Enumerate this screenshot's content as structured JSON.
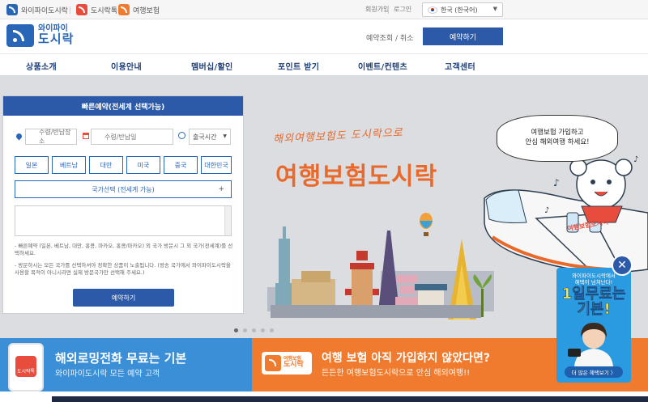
{
  "topbar": {
    "sites": [
      {
        "label": "와이파이도시락",
        "icon": "wifi-dosirak-icon"
      },
      {
        "label": "도시락톡",
        "icon": "dosirak-talk-icon"
      },
      {
        "label": "여행보험",
        "icon": "travel-insurance-icon"
      }
    ],
    "signup": "회원가입",
    "login": "로그인",
    "language": "한국 (한국어)"
  },
  "header": {
    "logo_small": "와이파이",
    "logo_big": "도시락",
    "reservation_lookup": "예약조회 / 취소",
    "reserve_button": "예약하기"
  },
  "nav": [
    "상품소개",
    "이용안내",
    "멤버십/할인",
    "포인트 받기",
    "이벤트/컨텐츠",
    "고객센터"
  ],
  "quick_booking": {
    "title": "빠른예약(전세계 선택가능)",
    "pickup_placeholder": "수령/반납장소",
    "date_placeholder": "수령/반납일",
    "departure_time": "출국시간",
    "countries": [
      "일본",
      "베트남",
      "대만",
      "미국",
      "중국",
      "대한민국"
    ],
    "country_select": "국가선택 (전세계 가능)",
    "note1": "- 빠른예약 (일본, 베트남, 대만, 홍콩, 마카오, 홍콩/마카오) 외 국가 방문시 그 외 국가(전세계)를 선택하세요.",
    "note2": "- 방문하시는 모든 국가를 선택하셔야 정확한 상품이 노출됩니다. (왕송 국가에서 와이파이도시락을 사용할 목적이 아니시라면 실제 방문국가만 선택해 주세요.)",
    "submit": "예약하기"
  },
  "hero": {
    "handwriting": "해외여행보험도 도시락으로",
    "title": "여행보험도시락",
    "bubble_line1": "여행보험 가입하고",
    "bubble_line2": "안심 해외여행 하세요!",
    "plane_label": "여행보험도시락",
    "slide_count": 5,
    "active_slide": 0
  },
  "side_promo": {
    "line1": "와이파이도시락에서",
    "line2": "혜택이 넘쳐난다!",
    "big1": "1일무료는",
    "big2": "기본!",
    "button": "더 많은 혜택보기 〉",
    "close": "✕"
  },
  "banners": {
    "left_title": "해외로밍전화 무료는 기본",
    "left_sub": "와이파이도시락 모든 예약 고객",
    "left_app": "도시락톡",
    "right_logo_small": "여행보험",
    "right_logo_big": "도시락",
    "right_title": "여행 보험 아직 가입하지 않았다면?",
    "right_sub": "든든한 여행보험도시락으로 안심 해외여행!!"
  },
  "colors": {
    "primary_blue": "#2d5aa8",
    "brand_orange": "#e9692a",
    "banner_blue": "#3a8fd6",
    "banner_orange": "#f07b2e"
  }
}
